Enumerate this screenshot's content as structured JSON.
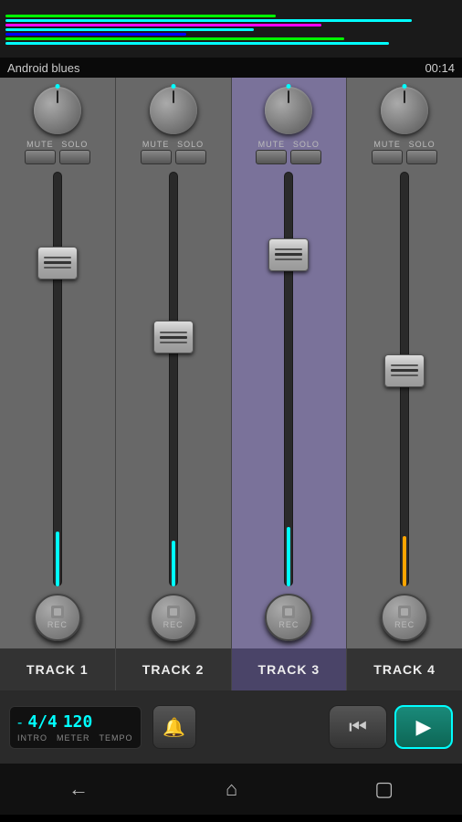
{
  "app": {
    "title": "Android blues",
    "time": "00:14"
  },
  "tracks": [
    {
      "id": 1,
      "name": "TRACK 1",
      "active": false,
      "faderPos": 20,
      "vuHeight": 60
    },
    {
      "id": 2,
      "name": "TRACK 2",
      "active": false,
      "faderPos": 38,
      "vuHeight": 50
    },
    {
      "id": 3,
      "name": "TRACK 3",
      "active": true,
      "faderPos": 18,
      "vuHeight": 65
    },
    {
      "id": 4,
      "name": "TRACK 4",
      "active": false,
      "faderPos": 45,
      "vuHeight": 55
    }
  ],
  "transport": {
    "minus": "-",
    "meter": "4/4",
    "tempo": "120",
    "intro_label": "INTRO",
    "meter_label": "METER",
    "tempo_label": "TEMPO",
    "rewind_icon": "⏮",
    "play_icon": "▶"
  },
  "nav": {
    "back_icon": "←",
    "home_icon": "⌂",
    "recents_icon": "▢"
  },
  "labels": {
    "mute": "MUTE",
    "solo": "SOLO",
    "rec": "REC"
  }
}
